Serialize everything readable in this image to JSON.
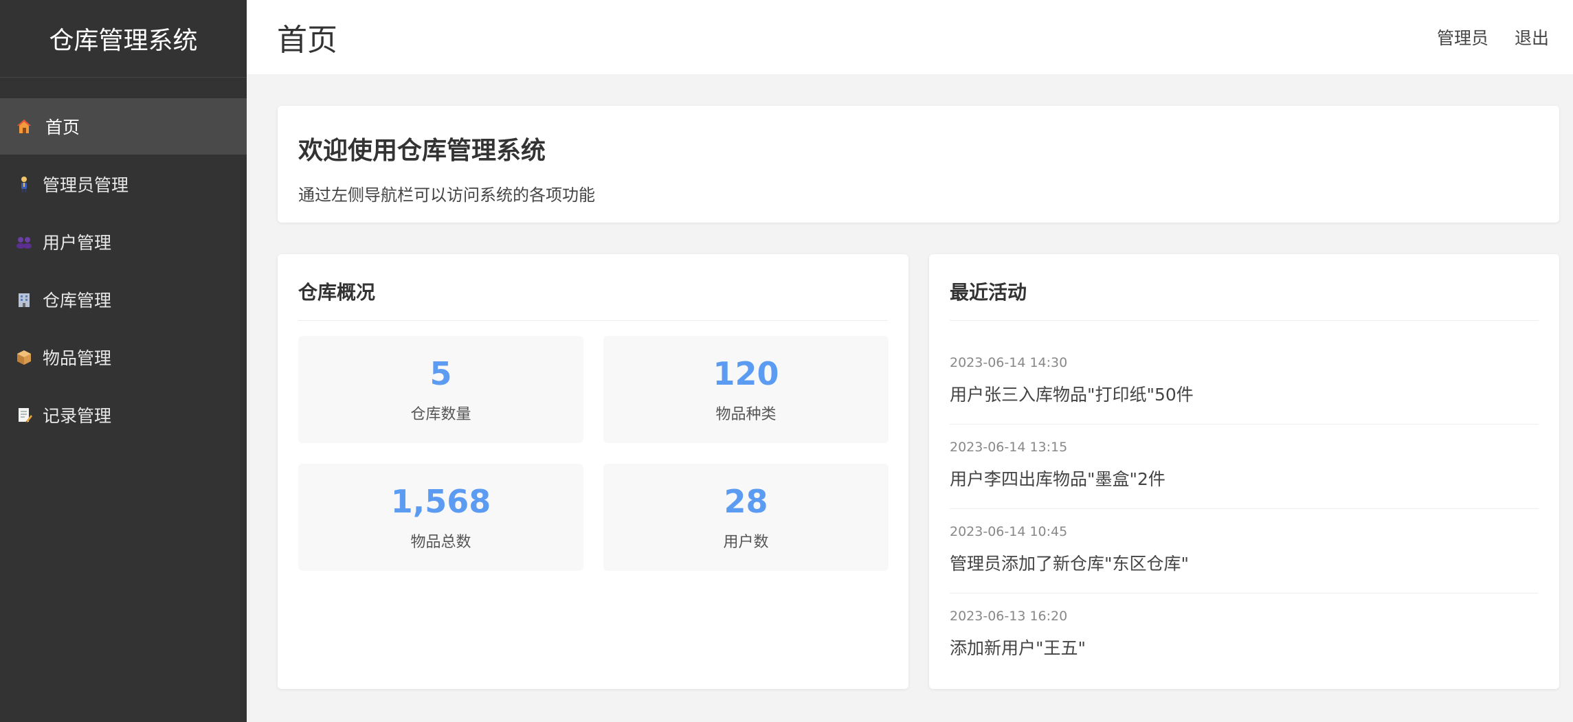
{
  "sidebar": {
    "brand": "仓库管理系统",
    "items": [
      {
        "label": "首页",
        "icon": "house-icon"
      },
      {
        "label": "管理员管理",
        "icon": "person-icon"
      },
      {
        "label": "用户管理",
        "icon": "users-icon"
      },
      {
        "label": "仓库管理",
        "icon": "building-icon"
      },
      {
        "label": "物品管理",
        "icon": "package-icon"
      },
      {
        "label": "记录管理",
        "icon": "memo-icon"
      }
    ]
  },
  "header": {
    "title": "首页",
    "user_label": "管理员",
    "logout_label": "退出"
  },
  "welcome": {
    "title": "欢迎使用仓库管理系统",
    "subtitle": "通过左侧导航栏可以访问系统的各项功能"
  },
  "overview": {
    "title": "仓库概况",
    "stats": [
      {
        "value": "5",
        "label": "仓库数量"
      },
      {
        "value": "120",
        "label": "物品种类"
      },
      {
        "value": "1,568",
        "label": "物品总数"
      },
      {
        "value": "28",
        "label": "用户数"
      }
    ]
  },
  "activity": {
    "title": "最近活动",
    "items": [
      {
        "time": "2023-06-14 14:30",
        "text": "用户张三入库物品\"打印纸\"50件"
      },
      {
        "time": "2023-06-14 13:15",
        "text": "用户李四出库物品\"墨盒\"2件"
      },
      {
        "time": "2023-06-14 10:45",
        "text": "管理员添加了新仓库\"东区仓库\""
      },
      {
        "time": "2023-06-13 16:20",
        "text": "添加新用户\"王五\""
      }
    ]
  },
  "colors": {
    "sidebar_bg": "#333333",
    "accent": "#5b9cf2",
    "page_bg": "#f3f3f3"
  }
}
